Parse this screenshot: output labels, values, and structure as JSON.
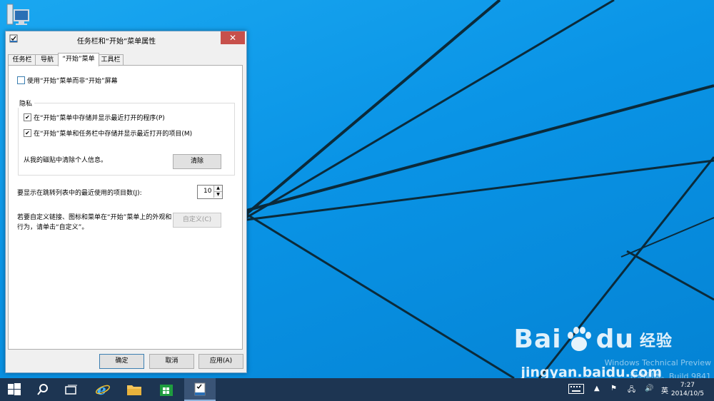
{
  "dialog": {
    "title": "任务栏和“开始”菜单属性",
    "close_label": "✕",
    "tabs": [
      {
        "label": "任务栏",
        "active": false
      },
      {
        "label": "导航",
        "active": false
      },
      {
        "label": "“开始”菜单",
        "active": true
      },
      {
        "label": "工具栏",
        "active": false
      }
    ],
    "use_start_menu": {
      "label": "使用“开始”菜单而非“开始”屏幕",
      "checked": false
    },
    "privacy": {
      "title": "隐私",
      "store_programs": {
        "label": "在“开始”菜单中存储并显示最近打开的程序(P)",
        "checked": true
      },
      "store_items": {
        "label": "在“开始”菜单和任务栏中存储并显示最近打开的项目(M)",
        "checked": true
      },
      "clear_text": "从我的磁贴中清除个人信息。",
      "clear_button": "清除"
    },
    "jumplist": {
      "label": "要显示在跳转列表中的最近使用的项目数(J):",
      "value": "10"
    },
    "customize": {
      "text_line1": "若要自定义链接、图标和菜单在“开始”菜单上的外观和",
      "text_line2": "行为，请单击“自定义”。",
      "button": "自定义(C)"
    },
    "buttons": {
      "ok": "确定",
      "cancel": "取消",
      "apply": "应用(A)"
    }
  },
  "desktop": {
    "os_line1": "Windows Technical Preview",
    "os_line2": "评估副本。Build 9841",
    "watermark_brand_left": "Bai",
    "watermark_brand_right": "du",
    "watermark_jing": "经验",
    "watermark_url": "jingyan.baidu.com"
  },
  "taskbar": {
    "ime": "英",
    "time": "7:27",
    "date": "2014/10/5"
  },
  "colors": {
    "desktop": "#0a94e6",
    "taskbar": "#1d3552",
    "close": "#c7504b",
    "accent": "#3c7fb1"
  }
}
